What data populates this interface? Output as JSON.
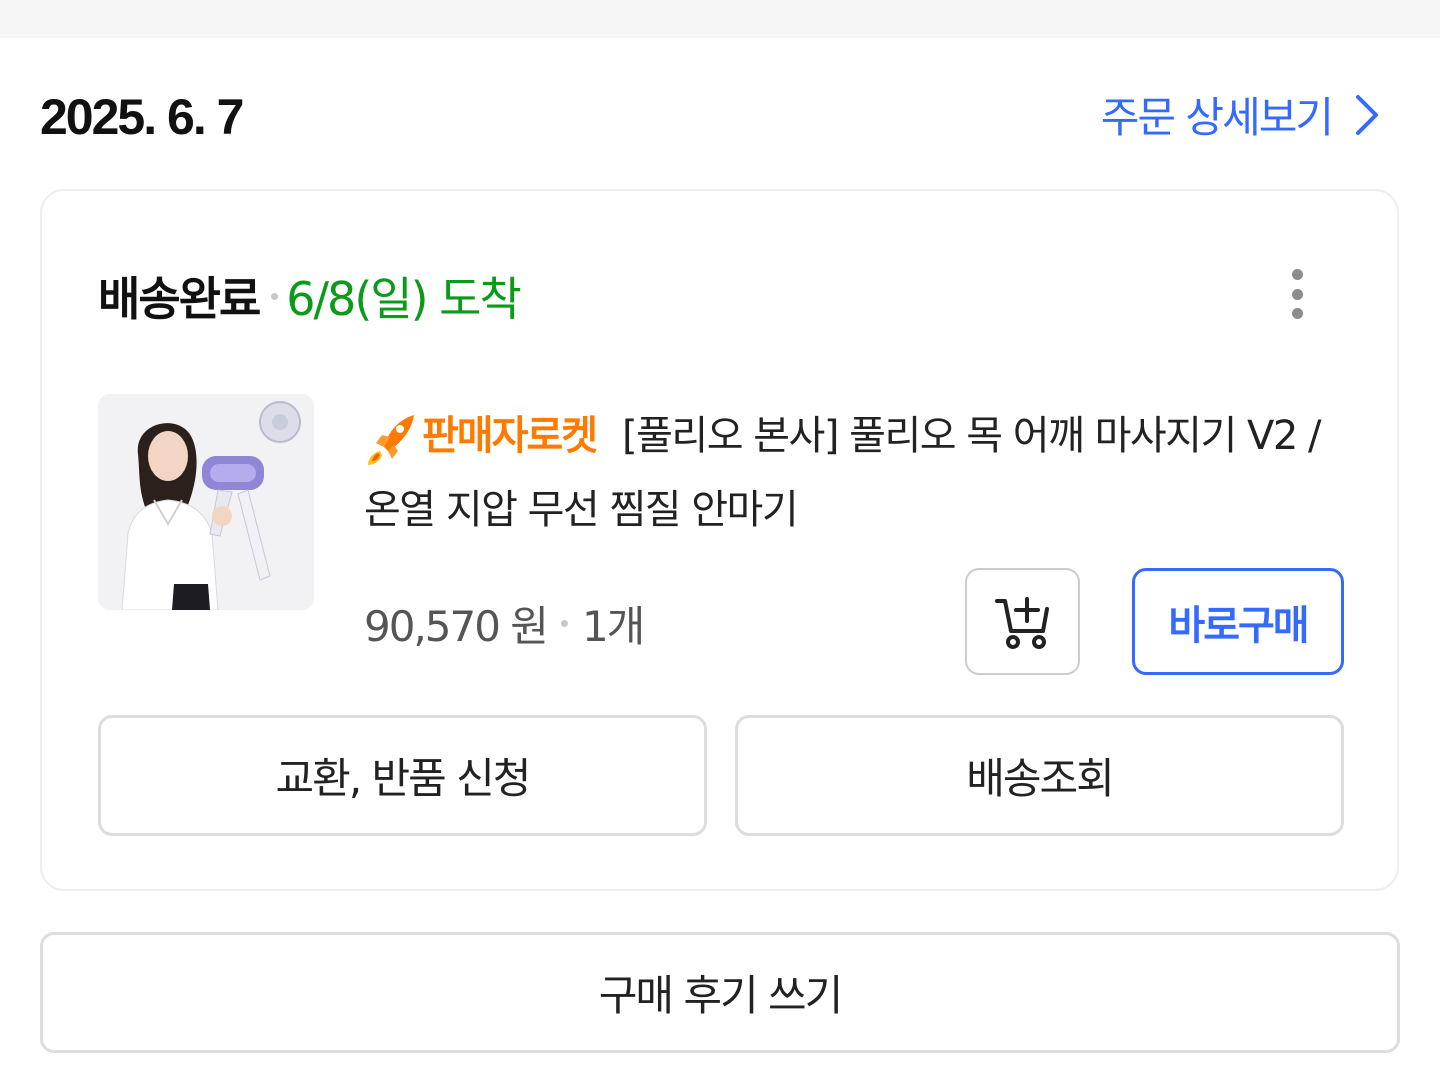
{
  "order": {
    "date": "2025. 6. 7",
    "detail_link_label": "주문 상세보기"
  },
  "shipment": {
    "status": "배송완료",
    "arrival": "6/8(일) 도착"
  },
  "product": {
    "badge": "판매자로켓",
    "title": "[풀리오 본사] 풀리오 목 어깨 마사지기 V2 / 온열 지압 무선 찜질 안마기",
    "price": "90,570 원",
    "quantity": "1개"
  },
  "buttons": {
    "buy_now": "바로구매",
    "exchange_return": "교환, 반품 신청",
    "track_delivery": "배송조회",
    "write_review": "구매 후기 쓰기"
  },
  "icons": {
    "detail_arrow": "chevron-right-icon",
    "more": "more-vertical-icon",
    "rocket": "rocket-icon",
    "cart": "add-to-cart-icon"
  },
  "colors": {
    "accent": "#346aff",
    "arrival_green": "#0b9a19",
    "rocket_orange": "#ff7a00"
  }
}
